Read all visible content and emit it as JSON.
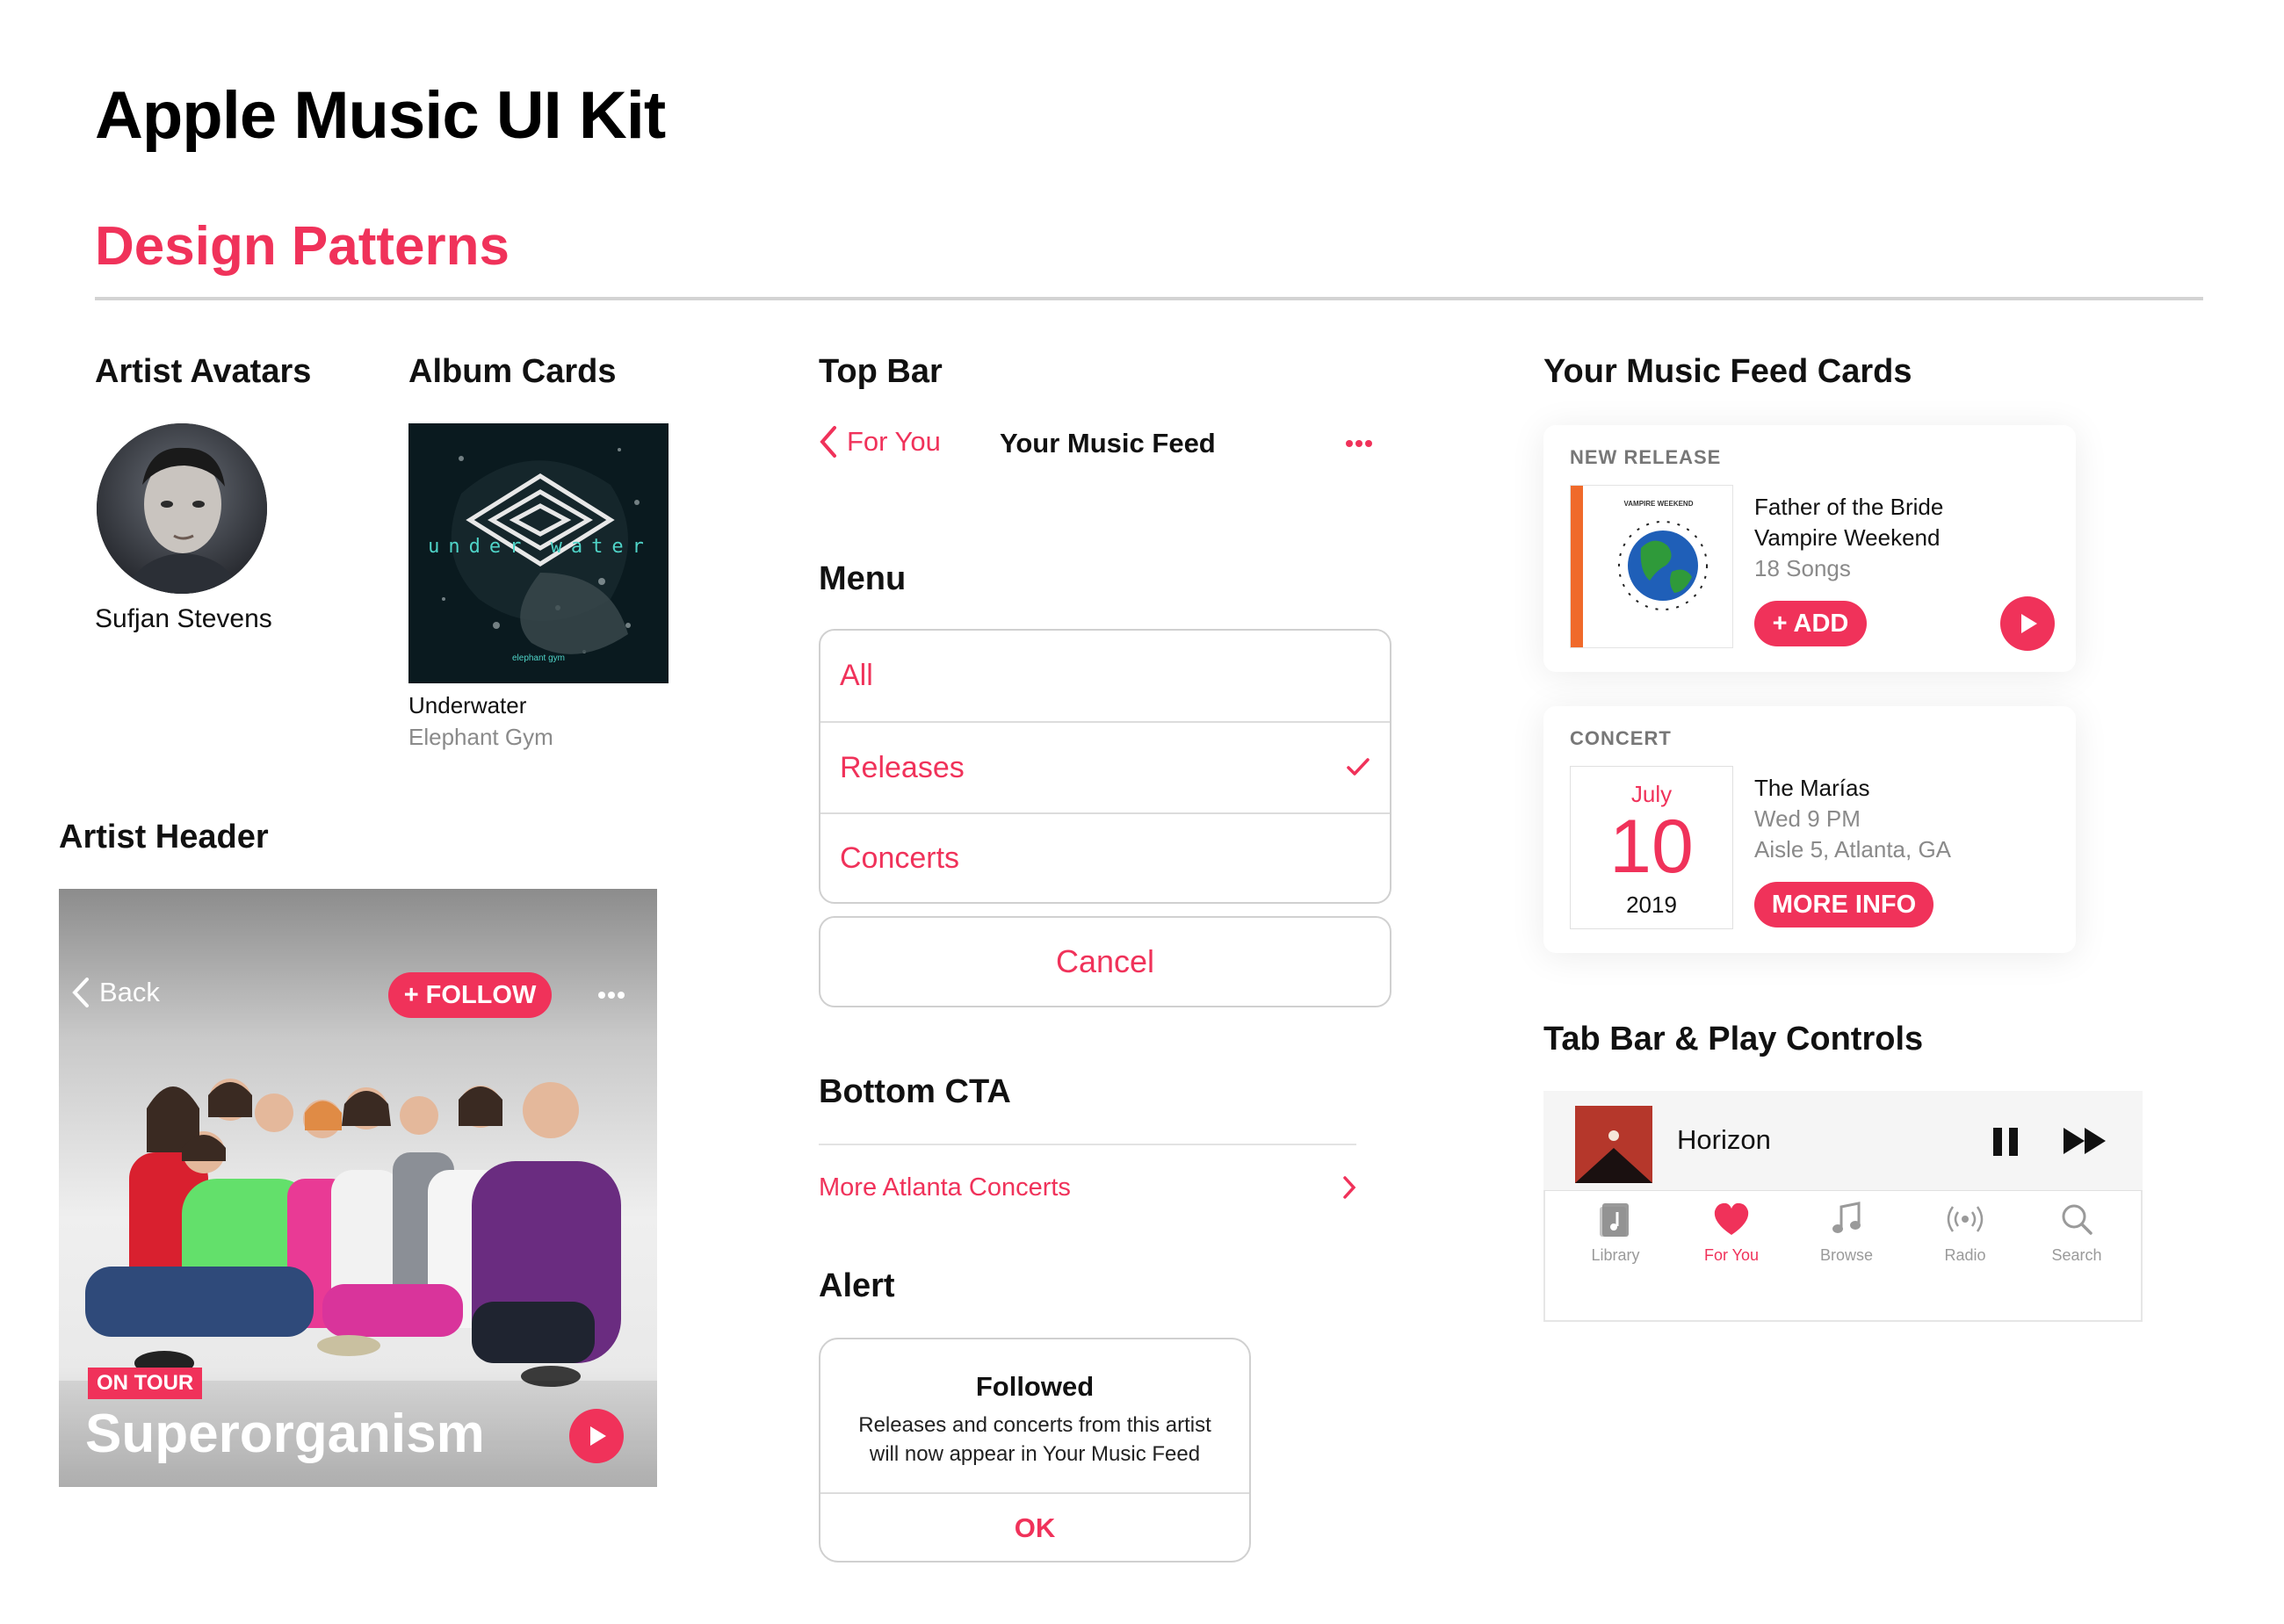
{
  "page": {
    "title": "Apple Music UI Kit",
    "subtitle": "Design Patterns"
  },
  "sections": {
    "artist_avatars": "Artist Avatars",
    "album_cards": "Album Cards",
    "artist_header": "Artist Header",
    "top_bar": "Top Bar",
    "menu": "Menu",
    "bottom_cta": "Bottom CTA",
    "alert": "Alert",
    "feed_cards": "Your Music Feed Cards",
    "tab_bar": "Tab Bar & Play Controls"
  },
  "avatar": {
    "name": "Sufjan Stevens"
  },
  "album": {
    "cover_text": "under water",
    "cover_small": "elephant gym",
    "title": "Underwater",
    "artist": "Elephant Gym"
  },
  "artist_header": {
    "back_label": "Back",
    "follow_label": "+ FOLLOW",
    "badge": "ON TOUR",
    "artist_name": "Superorganism"
  },
  "top_bar": {
    "back_label": "For You",
    "title": "Your Music Feed"
  },
  "menu": {
    "items": [
      {
        "label": "All"
      },
      {
        "label": "Releases",
        "checked": true
      },
      {
        "label": "Concerts"
      }
    ],
    "cancel": "Cancel"
  },
  "bottom_cta": {
    "label": "More Atlanta Concerts"
  },
  "alert": {
    "title": "Followed",
    "message_line1": "Releases and concerts from this artist",
    "message_line2": "will now appear in Your Music Feed",
    "ok": "OK"
  },
  "release_card": {
    "label": "NEW RELEASE",
    "cover_text": "VAMPIRE WEEKEND",
    "album": "Father of the Bride",
    "artist": "Vampire Weekend",
    "songs": "18 Songs",
    "add_label": "+ ADD"
  },
  "concert_card": {
    "label": "CONCERT",
    "month": "July",
    "day": "10",
    "year": "2019",
    "artist": "The Marías",
    "time": "Wed 9 PM",
    "venue": "Aisle 5, Atlanta, GA",
    "more_label": "MORE INFO"
  },
  "player": {
    "track": "Horizon"
  },
  "tabs": [
    {
      "label": "Library",
      "icon": "library-icon",
      "active": false
    },
    {
      "label": "For You",
      "icon": "heart-icon",
      "active": true
    },
    {
      "label": "Browse",
      "icon": "music-note-icon",
      "active": false
    },
    {
      "label": "Radio",
      "icon": "radio-icon",
      "active": false
    },
    {
      "label": "Search",
      "icon": "search-icon",
      "active": false
    }
  ],
  "colors": {
    "accent": "#f0325a",
    "text": "#111111",
    "secondary": "#8a8a8a",
    "divider": "#d3d3d3"
  }
}
